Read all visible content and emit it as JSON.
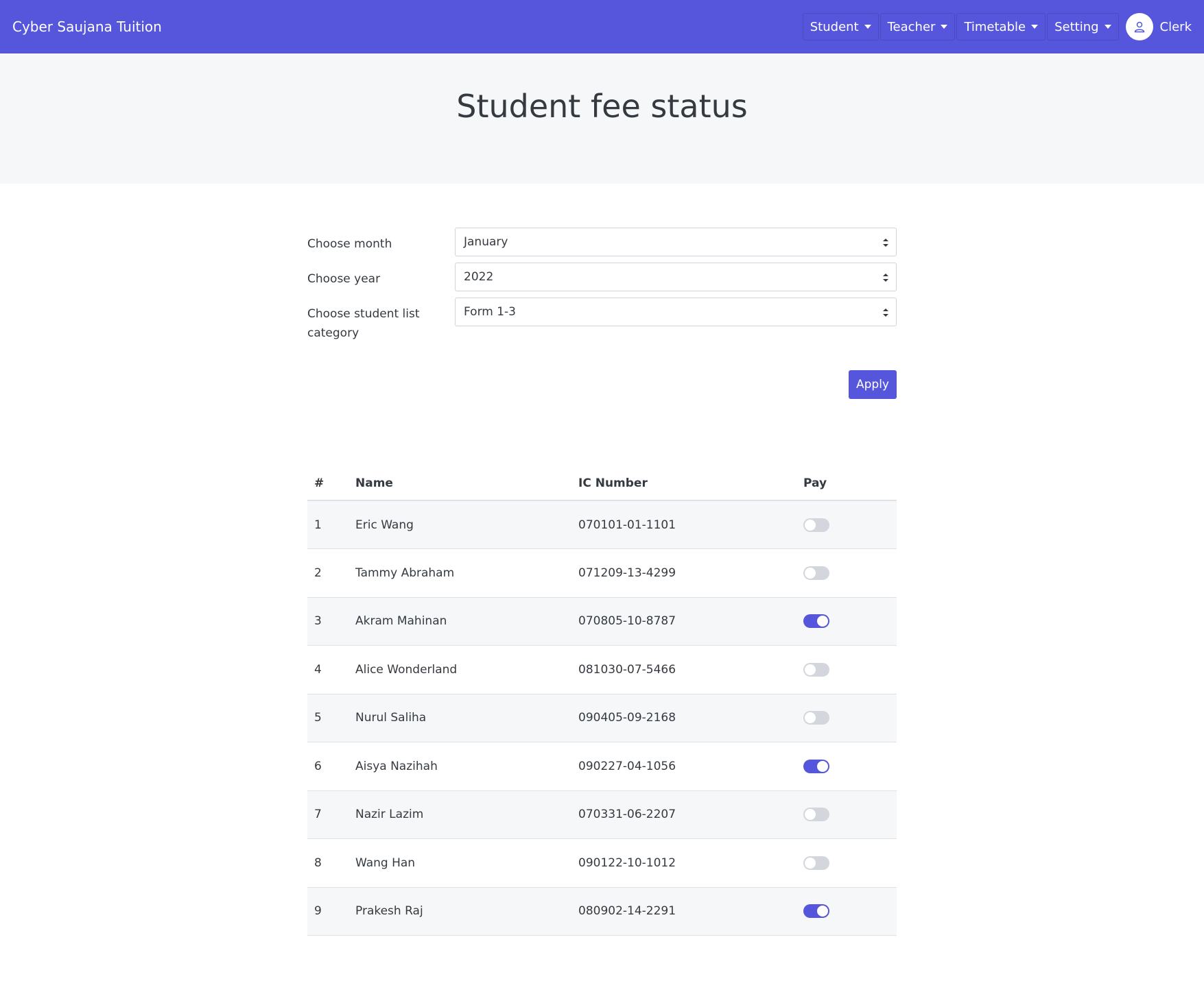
{
  "app": {
    "brand": "Cyber Saujana Tuition"
  },
  "nav": {
    "items": [
      {
        "label": "Student"
      },
      {
        "label": "Teacher"
      },
      {
        "label": "Timetable"
      },
      {
        "label": "Setting"
      }
    ],
    "user_label": "Clerk"
  },
  "page": {
    "title": "Student fee status"
  },
  "form": {
    "month": {
      "label": "Choose month",
      "value": "January"
    },
    "year": {
      "label": "Choose year",
      "value": "2022"
    },
    "category": {
      "label": "Choose student list category",
      "value": "Form 1-3"
    },
    "apply_label": "Apply"
  },
  "table": {
    "headers": {
      "idx": "#",
      "name": "Name",
      "ic": "IC Number",
      "pay": "Pay"
    },
    "rows": [
      {
        "idx": "1",
        "name": "Eric Wang",
        "ic": "070101-01-1101",
        "paid": false
      },
      {
        "idx": "2",
        "name": "Tammy Abraham",
        "ic": "071209-13-4299",
        "paid": false
      },
      {
        "idx": "3",
        "name": "Akram Mahinan",
        "ic": "070805-10-8787",
        "paid": true
      },
      {
        "idx": "4",
        "name": "Alice Wonderland",
        "ic": "081030-07-5466",
        "paid": false
      },
      {
        "idx": "5",
        "name": "Nurul Saliha",
        "ic": "090405-09-2168",
        "paid": false
      },
      {
        "idx": "6",
        "name": "Aisya Nazihah",
        "ic": "090227-04-1056",
        "paid": true
      },
      {
        "idx": "7",
        "name": "Nazir Lazim",
        "ic": "070331-06-2207",
        "paid": false
      },
      {
        "idx": "8",
        "name": "Wang Han",
        "ic": "090122-10-1012",
        "paid": false
      },
      {
        "idx": "9",
        "name": "Prakesh Raj",
        "ic": "080902-14-2291",
        "paid": true
      }
    ]
  },
  "icons": {
    "user": "user-icon",
    "caret": "caret-down-icon",
    "select": "select-arrows-icon"
  },
  "colors": {
    "primary": "#5656dc",
    "band": "#f6f7f9",
    "toggle_off": "#d3d6dc"
  }
}
